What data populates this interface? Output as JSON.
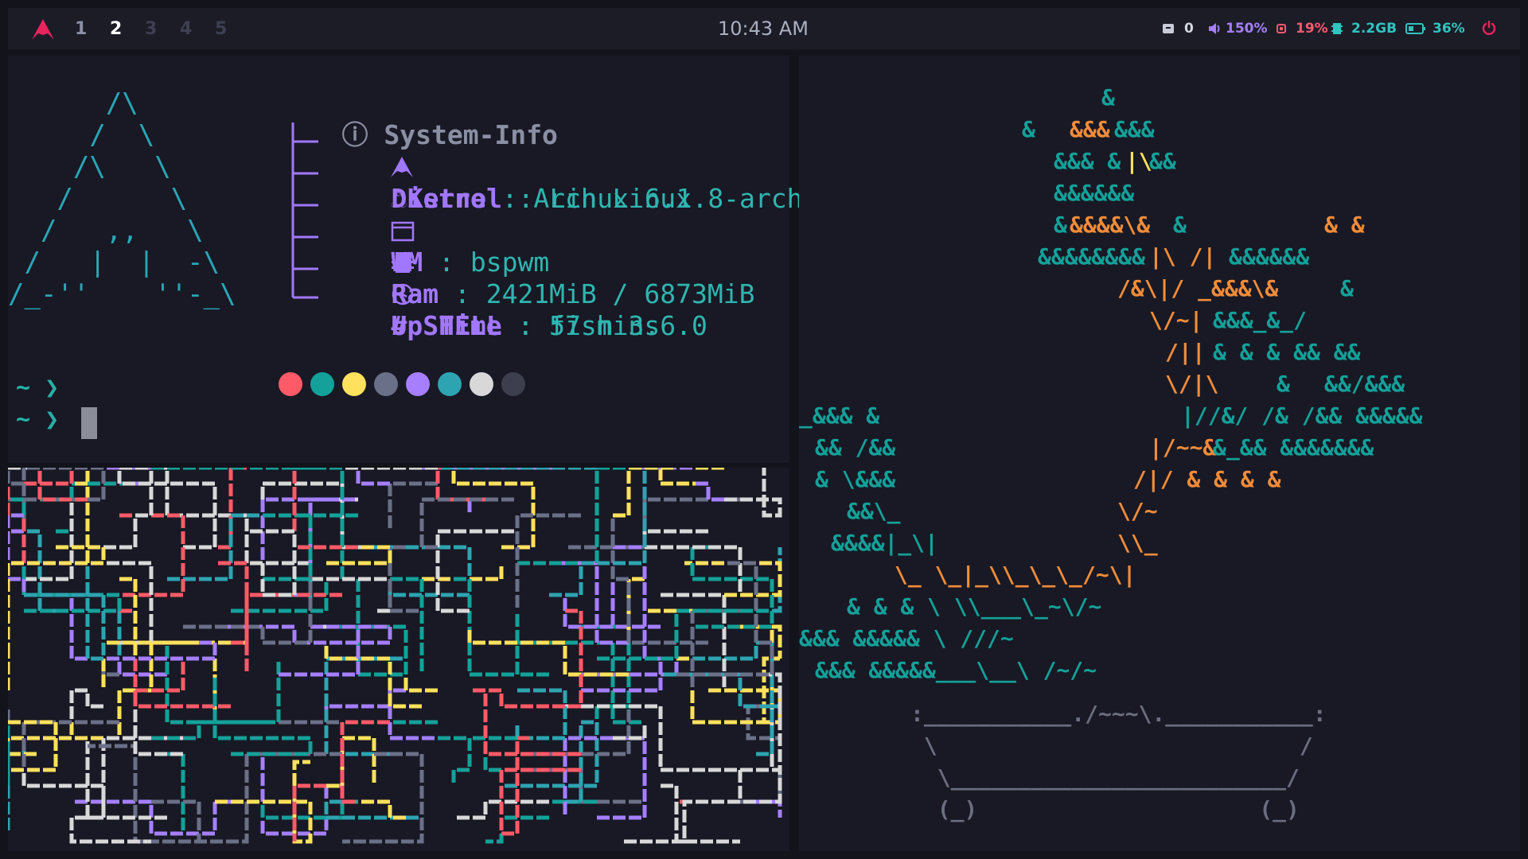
{
  "topbar": {
    "workspaces": [
      "1",
      "2",
      "3",
      "4",
      "5"
    ],
    "active_workspace": "2",
    "clock": "10:43 AM",
    "updates_count": "0",
    "volume": "150%",
    "cpu": "19%",
    "memory": "2.2GB",
    "battery": "36%",
    "colors": {
      "accent": "#e8245e",
      "volume": "#a57fff",
      "cpu": "#ff5a6e",
      "memory": "#31c3c0",
      "battery": "#31c3c0",
      "power": "#e8245e"
    }
  },
  "fetch": {
    "title": "System-Info",
    "rows": [
      {
        "icon": "arch-icon",
        "key": "Distro",
        "sep": " : ",
        "value": "Arch Linux"
      },
      {
        "icon": "linux-penguin-icon",
        "key": "Kernel",
        "sep": " : ",
        "value": "Linux 6.1.8-arch1"
      },
      {
        "icon": "window-icon",
        "key": "WM",
        "sep": " : ",
        "value": "bspwm"
      },
      {
        "icon": "memory-chip-icon",
        "key": "Ram",
        "sep": " : ",
        "value": "2421MiB / 6873MiB"
      },
      {
        "icon": "clock-icon",
        "key": "Up Time",
        "sep": " : ",
        "value": "57 mins"
      },
      {
        "icon": "hash-icon",
        "key": "SHELL",
        "sep": " : ",
        "value": "fish 3.6.0"
      }
    ],
    "palette": [
      "#ff5a67",
      "#14a19a",
      "#ffe15d",
      "#6b7089",
      "#a57fff",
      "#2ea4b2",
      "#d8d8d8",
      "#3d3f4f"
    ]
  },
  "terminal": {
    "prompt_symbol": "~ ❯",
    "ascii_logo": "      /\\\n     /  \\\n    /\\   \\\n   /      \\\n  /   ,,   \\\n /   |  |  -\\\n/_-''    ''-_\\"
  },
  "bonsai": {
    "pot_top": ":___________./~~~\\.___________:",
    "pot_side": " \\                           /",
    "pot_base": "  \\_________________________/",
    "feet": "  (_)                     (_)"
  }
}
